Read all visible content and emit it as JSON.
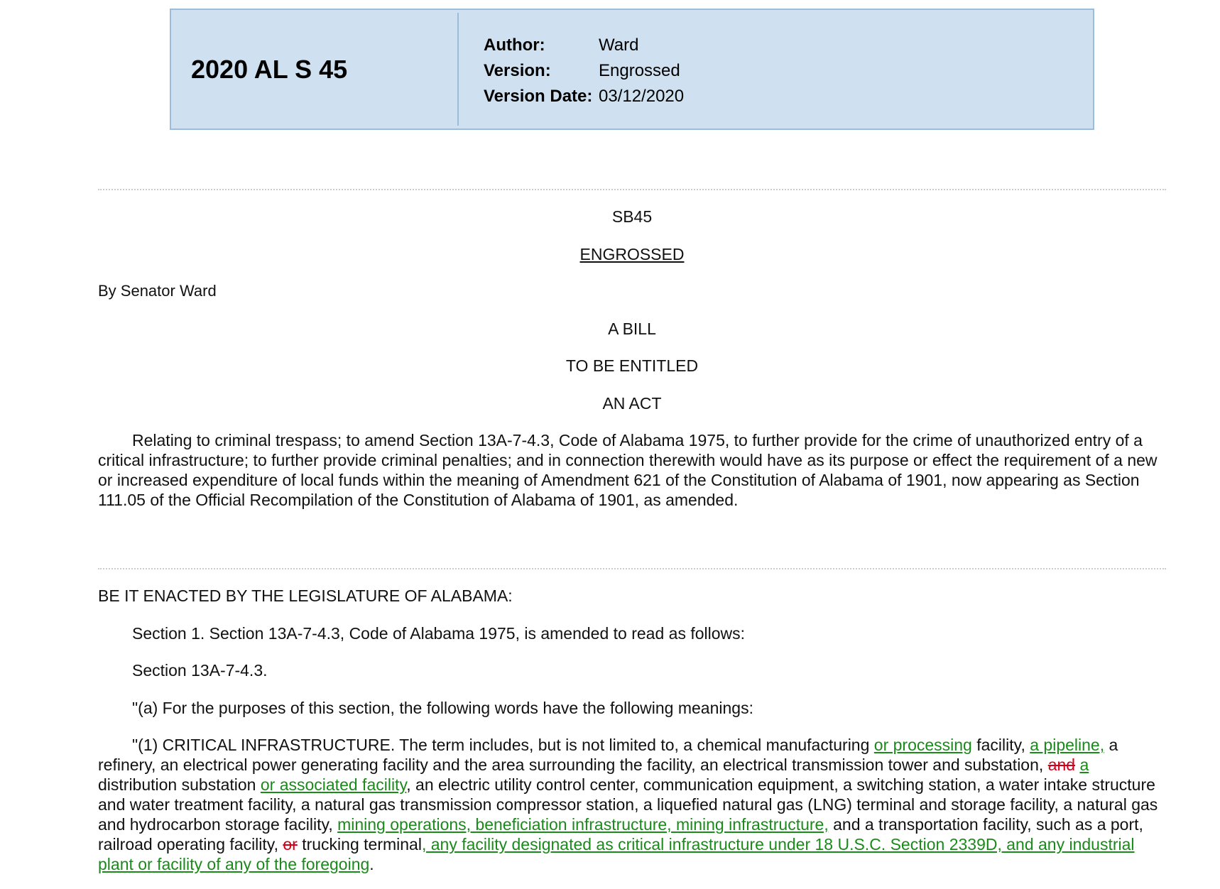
{
  "header": {
    "doc_id": "2020 AL S 45",
    "author_label": "Author:",
    "author": "Ward",
    "version_label": "Version:",
    "version": "Engrossed",
    "version_date_label": "Version Date:",
    "version_date": "03/12/2020"
  },
  "bill": {
    "number": "SB45",
    "status": "ENGROSSED",
    "sponsor": "By Senator Ward",
    "title1": "A BILL",
    "title2": "TO BE ENTITLED",
    "title3": "AN ACT",
    "synopsis": "Relating to criminal trespass; to amend Section 13A-7-4.3, Code of Alabama 1975, to further provide for the crime of unauthorized entry of a critical infrastructure; to further provide criminal penalties; and in connection therewith would have as its purpose or effect the requirement of a new or increased expenditure of local funds within the meaning of Amendment 621 of the Constitution of Alabama of 1901, now appearing as Section 111.05 of the Official Recompilation of the Constitution of Alabama of 1901, as amended."
  },
  "body": {
    "enacting": "BE IT ENACTED BY THE LEGISLATURE OF ALABAMA:",
    "section1": "Section 1. Section 13A-7-4.3, Code of Alabama 1975, is amended to read as follows:",
    "section_heading": "Section 13A-7-4.3.",
    "para_a": "\"(a) For the purposes of this section, the following words have the following meanings:",
    "para_1": {
      "t1": "\"(1) CRITICAL INFRASTRUCTURE. The term includes, but is not limited to, a chemical manufacturing ",
      "ins1": "or processing",
      "t2": " facility, ",
      "ins2": "a pipeline,",
      "t3": " a refinery, an electrical power generating facility and the area surrounding the facility, an electrical transmission tower and substation, ",
      "del1": "and",
      "t4": " ",
      "ins3": "a",
      "t5": " distribution substation ",
      "ins4": "or associated facility",
      "t6": ", an electric utility control center, communication equipment, a switching station, a water intake structure and water treatment facility, a natural gas transmission compressor station, a liquefied natural gas (LNG) terminal and storage facility, a natural gas and hydrocarbon storage facility, ",
      "ins5": "mining operations, beneficiation infrastructure, mining infrastructure,",
      "t7": " and a transportation facility, such as a port, railroad operating facility, ",
      "del2": "or",
      "t8": " trucking terminal",
      "ins6": ", any facility designated as critical infrastructure under 18 U.S.C. Section 2339D, and any industrial plant or facility of any of the foregoing",
      "t9": "."
    }
  }
}
